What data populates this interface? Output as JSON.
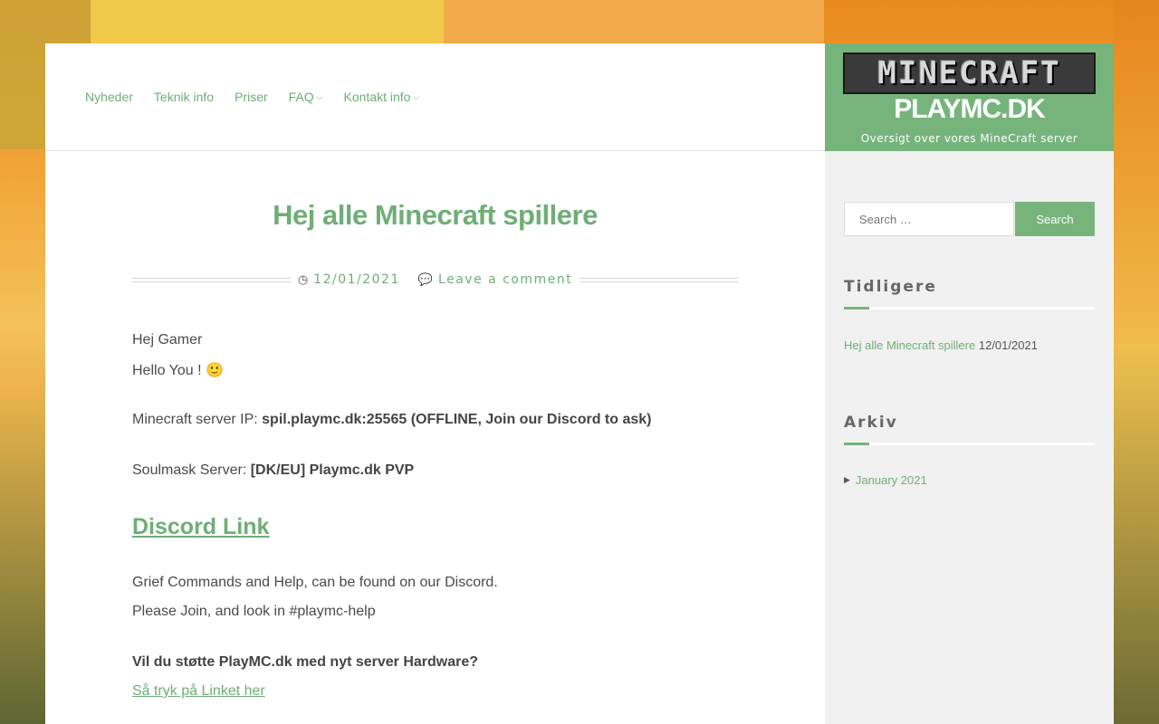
{
  "nav": {
    "items": [
      {
        "label": "Nyheder",
        "has_dropdown": false
      },
      {
        "label": "Teknik info",
        "has_dropdown": false
      },
      {
        "label": "Priser",
        "has_dropdown": false
      },
      {
        "label": "FAQ",
        "has_dropdown": true
      },
      {
        "label": "Kontakt info",
        "has_dropdown": true
      }
    ]
  },
  "brand": {
    "logo_text": "MINECRAFT",
    "site_title": "PLAYMC.DK",
    "site_description": "Oversigt over vores MineCraft server",
    "color": "#76b47c"
  },
  "post": {
    "title": "Hej alle Minecraft spillere",
    "date": "12/01/2021",
    "comments_link": "Leave a comment",
    "greeting": "Hej Gamer",
    "hello": "Hello You ! 🙂",
    "server_ip_label": "Minecraft server IP: ",
    "server_ip_value": "spil.playmc.dk:25565 (OFFLINE, Join our Discord to ask)",
    "soulmask_label": "Soulmask Server: ",
    "soulmask_value": "[DK/EU] Playmc.dk PVP",
    "discord_link": "Discord Link",
    "grief_text": "Grief Commands and Help, can be found on our Discord.",
    "join_text": "Please Join, and look in #playmc-help",
    "support_question": "Vil du støtte PlayMC.dk med nyt server Hardware?",
    "support_link": "Så tryk på Linket her"
  },
  "sidebar": {
    "search_placeholder": "Search …",
    "search_button": "Search",
    "recent_title": "Tidligere",
    "recent_posts": [
      {
        "title": "Hej alle Minecraft spillere",
        "date": "12/01/2021"
      }
    ],
    "archive_title": "Arkiv",
    "archive_items": [
      {
        "label": "January 2021"
      }
    ]
  },
  "icons": {
    "date": "clock-icon",
    "comments": "comment-icon",
    "archive_bullet": "caret-right-icon"
  },
  "colors": {
    "accent": "#6fae76",
    "sidebar_bg": "#f1f1f1"
  }
}
